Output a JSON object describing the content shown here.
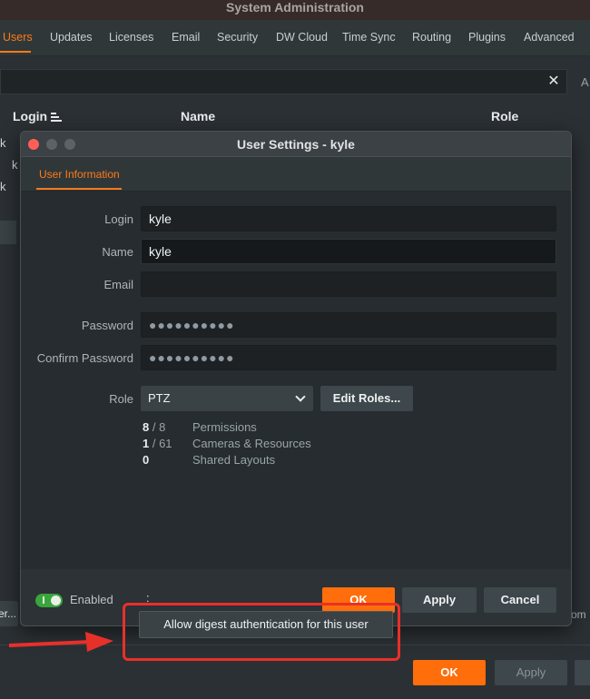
{
  "window_title": "System Administration",
  "tabs": [
    {
      "label": "Users"
    },
    {
      "label": "Updates"
    },
    {
      "label": "Licenses"
    },
    {
      "label": "Email"
    },
    {
      "label": "Security"
    },
    {
      "label": "DW Cloud"
    },
    {
      "label": "Time Sync"
    },
    {
      "label": "Routing"
    },
    {
      "label": "Plugins"
    },
    {
      "label": "Advanced"
    }
  ],
  "search": {
    "value": "",
    "clear_glyph": "✕"
  },
  "cut_label_right": "A",
  "table": {
    "columns": [
      "Login",
      "Name",
      "Role"
    ],
    "partial_row_glyphs": [
      "k",
      "k",
      "k"
    ]
  },
  "background_buttons": {
    "left_partial": "er...",
    "right_partial": "rom",
    "ok": "OK",
    "apply": "Apply"
  },
  "dialog": {
    "title": "User Settings - kyle",
    "tab": "User Information",
    "fields": {
      "login": {
        "label": "Login",
        "value": "kyle"
      },
      "name": {
        "label": "Name",
        "value": "kyle"
      },
      "email": {
        "label": "Email",
        "value": ""
      },
      "password": {
        "label": "Password",
        "value": "●●●●●●●●●●"
      },
      "confirm_password": {
        "label": "Confirm Password",
        "value": "●●●●●●●●●●"
      },
      "role": {
        "label": "Role",
        "value": "PTZ"
      }
    },
    "edit_roles_button": "Edit Roles...",
    "stats": [
      {
        "value": "8",
        "total": " / 8",
        "label": "Permissions"
      },
      {
        "value": "1",
        "total": " / 61",
        "label": "Cameras & Resources"
      },
      {
        "value": "0",
        "total": "",
        "label": "Shared Layouts"
      }
    ],
    "enabled_label": "Enabled",
    "enabled": true,
    "more_glyph": ":",
    "buttons": {
      "ok": "OK",
      "apply": "Apply",
      "cancel": "Cancel"
    }
  },
  "tooltip": "Allow digest authentication for this user",
  "colors": {
    "accent": "#ff7a1a",
    "ok": "#ff6e0a",
    "annotation": "#e8302a",
    "toggle_on": "#3aa53c"
  },
  "icons": [
    "sort-icon",
    "close-icon",
    "chevron-down-icon",
    "toggle-icon",
    "arrow-right-icon"
  ]
}
